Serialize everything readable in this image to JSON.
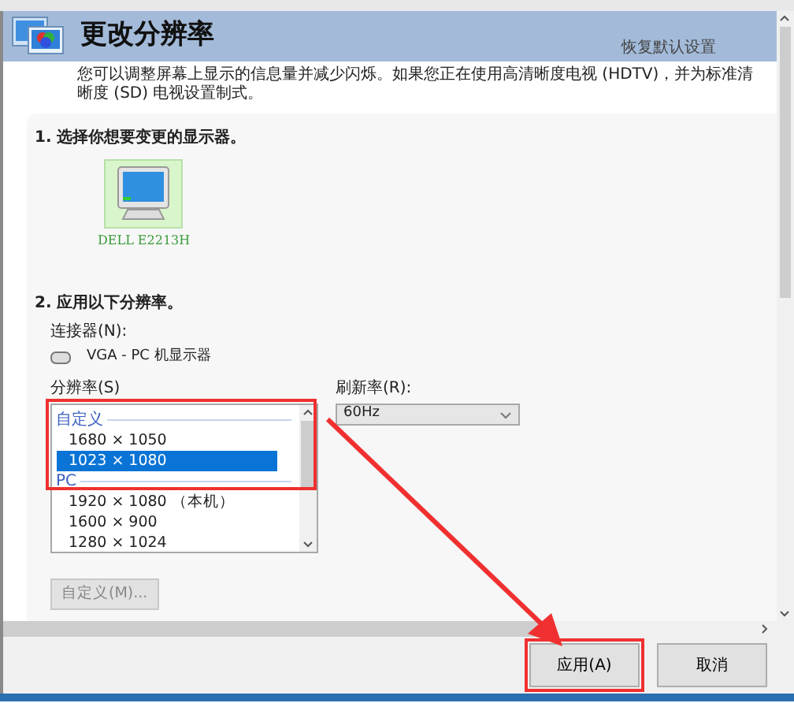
{
  "header": {
    "title": "更改分辨率",
    "restore_link": "恢复默认设置"
  },
  "description": "您可以调整屏幕上显示的信息量并减少闪烁。如果您正在使用高清晰度电视 (HDTV)，并为标准清晰度 (SD) 电视设置制式。",
  "step1": {
    "heading": "1. 选择你想要变更的显示器。",
    "displays": [
      {
        "name": "DELL E2213H",
        "selected": true
      }
    ]
  },
  "step2": {
    "heading": "2. 应用以下分辨率。",
    "connector_label": "连接器(N):",
    "connector": "VGA - PC 机显示器",
    "resolution_label": "分辨率(S)",
    "resolution_groups": [
      {
        "name": "自定义",
        "items": [
          {
            "label": "1680 × 1050",
            "selected": false
          },
          {
            "label": "1023 × 1080",
            "selected": true
          }
        ]
      },
      {
        "name": "PC",
        "items": [
          {
            "label": "1920 × 1080 （本机）",
            "selected": false
          },
          {
            "label": "1600 × 900",
            "selected": false
          },
          {
            "label": "1280 × 1024",
            "selected": false
          }
        ]
      }
    ],
    "list_highlighted": true,
    "refresh_label": "刷新率(R):",
    "refresh_value": "60Hz",
    "custom_button": {
      "label": "自定义(M)...",
      "disabled": true
    }
  },
  "buttons": [
    {
      "label": "应用(A)",
      "highlighted": true
    },
    {
      "label": "取消",
      "highlighted": false
    }
  ],
  "annotation_arrow": true
}
